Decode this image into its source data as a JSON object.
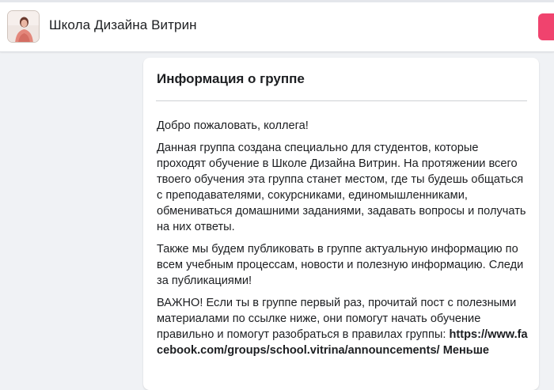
{
  "header": {
    "group_name": "Школа Дизайна Витрин"
  },
  "about": {
    "title": "Информация о группе",
    "greeting": "Добро пожаловать, коллега!",
    "paragraph1": "Данная группа создана специально для студентов, которые проходят обучение в Школе Дизайна Витрин. На протяжении всего твоего обучения эта группа станет местом, где ты будешь общаться с преподавателями, сокурсниками, единомышленниками, обмениваться домашними заданиями, задавать вопросы и получать на них ответы.",
    "paragraph2": "Также мы будем публиковать в группе актуальную информацию по всем учебным процессам, новости и полезную информацию. Следи за публикациями!",
    "paragraph3": "ВАЖНО! Если ты в группе первый раз, прочитай пост с полезными материалами по ссылке ниже, они помогут начать обучение правильно и помогут разобраться в правилах группы:",
    "link_text": "https://www.facebook.com/groups/school.vitrina/announcements/",
    "less_label": "Меньше"
  },
  "colors": {
    "accent": "#f0436e",
    "page_bg": "#f0f2f5"
  }
}
